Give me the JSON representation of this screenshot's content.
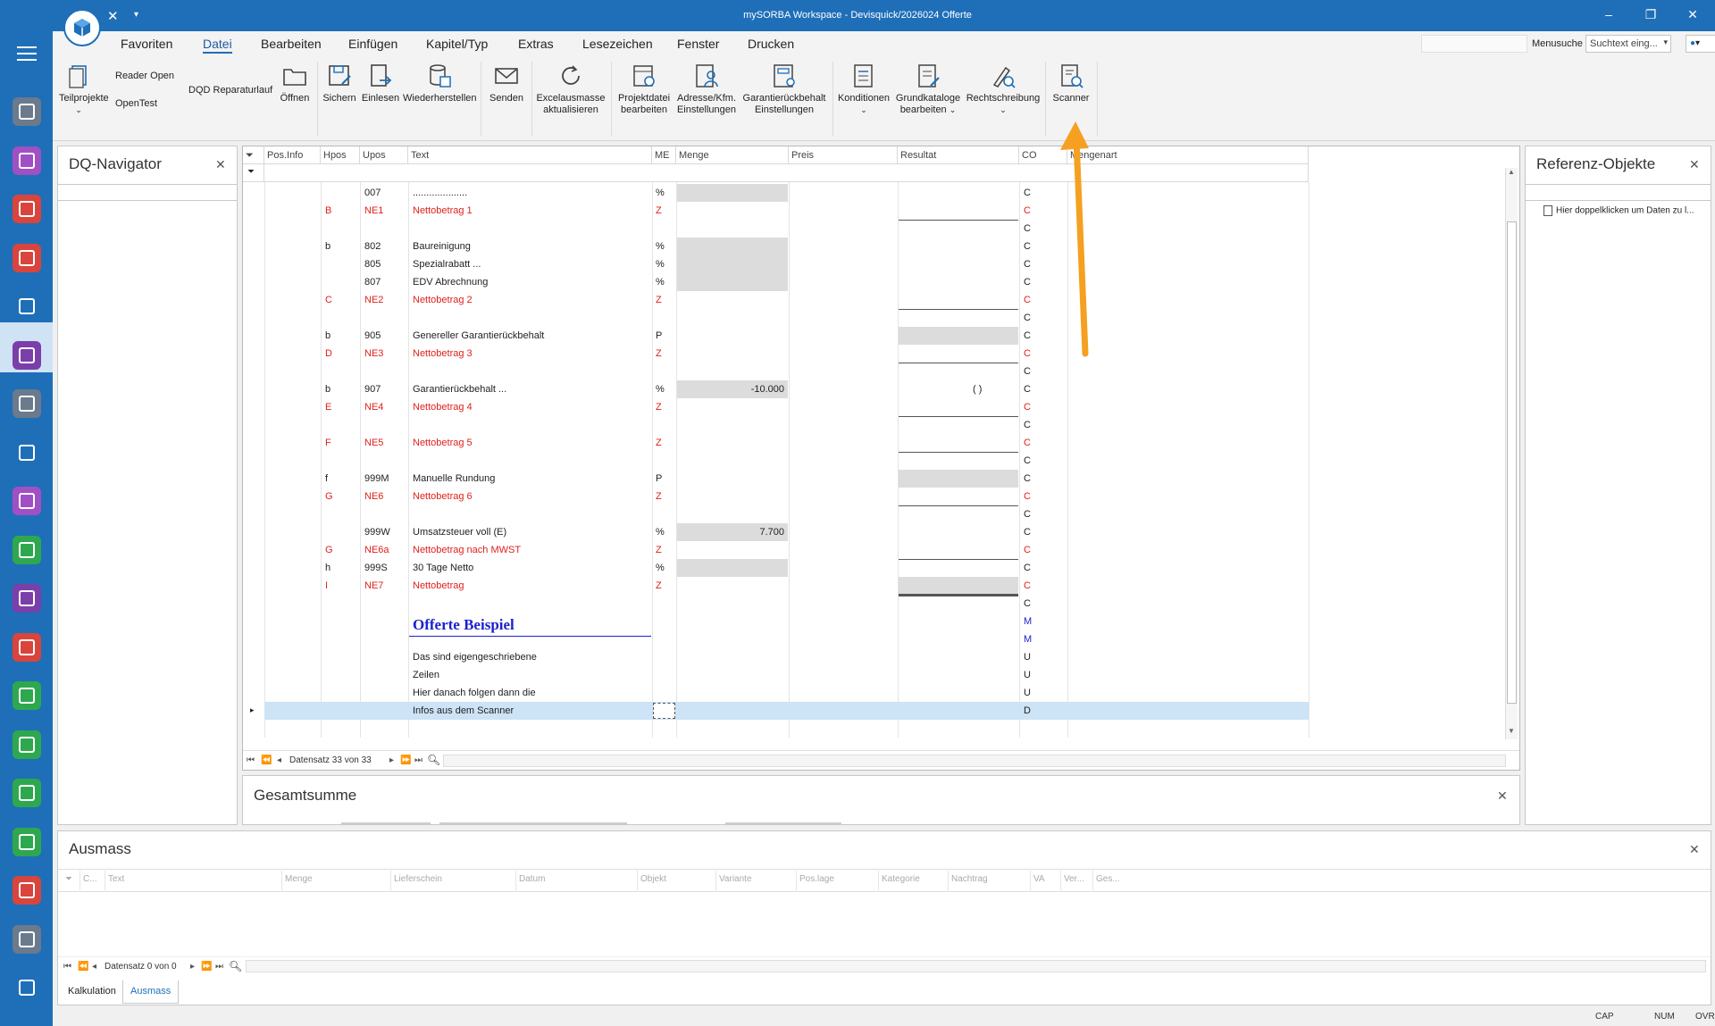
{
  "window": {
    "title": "mySORBA Workspace - Devisquick/2026024 Offerte",
    "minimize": "–",
    "restore": "❐",
    "close": "✕"
  },
  "menu_tabs": [
    "Favoriten",
    "Datei",
    "Bearbeiten",
    "Einfügen",
    "Kapitel/Typ",
    "Extras",
    "Lesezeichen",
    "Fenster",
    "Drucken"
  ],
  "active_tab": "Datei",
  "menusearch": {
    "label": "Menusuche",
    "placeholder": "Suchtext eing..."
  },
  "ribbon": {
    "teilprojekte": "Teilprojekte",
    "reader_open": "Reader Open",
    "opentest": "OpenTest",
    "dqd_reparaturlauf": "DQD Reparaturlauf",
    "oeffnen": "Öffnen",
    "sichern": "Sichern",
    "einlesen": "Einlesen",
    "wiederherstellen": "Wiederherstellen",
    "senden": "Senden",
    "excel1": "Excelausmasse",
    "excel2": "aktualisieren",
    "projekt1": "Projektdatei",
    "projekt2": "bearbeiten",
    "adresse1": "Adresse/Kfm.",
    "adresse2": "Einstellungen",
    "garantie1": "Garantierückbehalt",
    "garantie2": "Einstellungen",
    "konditionen": "Konditionen",
    "grund1": "Grundkataloge",
    "grund2": "bearbeiten",
    "recht": "Rechtschreibung",
    "scanner": "Scanner"
  },
  "dq_navigator": {
    "title": "DQ-Navigator"
  },
  "referenz": {
    "title": "Referenz-Objekte",
    "hint": "Hier doppelklicken um Daten zu l..."
  },
  "grid": {
    "columns": [
      "Pos.Info",
      "Hpos",
      "Upos",
      "Text",
      "ME",
      "Menge",
      "Preis",
      "Resultat",
      "CO",
      "Mengenart"
    ],
    "rows": [
      {
        "hpos": "",
        "upos": "007",
        "text": "....................",
        "me": "%",
        "menge": "",
        "res": "",
        "co": "C",
        "red": false
      },
      {
        "hpos": "B",
        "upos": "NE1",
        "text": "Nettobetrag 1",
        "me": "Z",
        "menge": "",
        "res": "",
        "co": "C",
        "red": true
      },
      {
        "hpos": "",
        "upos": "",
        "text": "",
        "me": "",
        "menge": "",
        "res": "",
        "co": "C",
        "red": false
      },
      {
        "hpos": "b",
        "upos": "802",
        "text": "Baureinigung",
        "me": "%",
        "menge": "",
        "res": "",
        "co": "C",
        "red": false
      },
      {
        "hpos": "",
        "upos": "805",
        "text": "Spezialrabatt ...",
        "me": "%",
        "menge": "",
        "res": "",
        "co": "C",
        "red": false
      },
      {
        "hpos": "",
        "upos": "807",
        "text": "EDV Abrechnung",
        "me": "%",
        "menge": "",
        "res": "",
        "co": "C",
        "red": false
      },
      {
        "hpos": "C",
        "upos": "NE2",
        "text": "Nettobetrag 2",
        "me": "Z",
        "menge": "",
        "res": "",
        "co": "C",
        "red": true
      },
      {
        "hpos": "",
        "upos": "",
        "text": "",
        "me": "",
        "menge": "",
        "res": "",
        "co": "C",
        "red": false
      },
      {
        "hpos": "b",
        "upos": "905",
        "text": "Genereller Garantierückbehalt",
        "me": "P",
        "menge": "",
        "res": "",
        "co": "C",
        "red": false
      },
      {
        "hpos": "D",
        "upos": "NE3",
        "text": "Nettobetrag 3",
        "me": "Z",
        "menge": "",
        "res": "",
        "co": "C",
        "red": true
      },
      {
        "hpos": "",
        "upos": "",
        "text": "",
        "me": "",
        "menge": "",
        "res": "",
        "co": "C",
        "red": false
      },
      {
        "hpos": "b",
        "upos": "907",
        "text": "Garantierückbehalt ...",
        "me": "%",
        "menge": "-10.000",
        "res": "(          )",
        "co": "C",
        "red": false
      },
      {
        "hpos": "E",
        "upos": "NE4",
        "text": "Nettobetrag 4",
        "me": "Z",
        "menge": "",
        "res": "",
        "co": "C",
        "red": true
      },
      {
        "hpos": "",
        "upos": "",
        "text": "",
        "me": "",
        "menge": "",
        "res": "",
        "co": "C",
        "red": false
      },
      {
        "hpos": "F",
        "upos": "NE5",
        "text": "Nettobetrag 5",
        "me": "Z",
        "menge": "",
        "res": "",
        "co": "C",
        "red": true
      },
      {
        "hpos": "",
        "upos": "",
        "text": "",
        "me": "",
        "menge": "",
        "res": "",
        "co": "C",
        "red": false
      },
      {
        "hpos": "f",
        "upos": "999M",
        "text": "Manuelle Rundung",
        "me": "P",
        "menge": "",
        "res": "",
        "co": "C",
        "red": false
      },
      {
        "hpos": "G",
        "upos": "NE6",
        "text": "Nettobetrag 6",
        "me": "Z",
        "menge": "",
        "res": "",
        "co": "C",
        "red": true
      },
      {
        "hpos": "",
        "upos": "",
        "text": "",
        "me": "",
        "menge": "",
        "res": "",
        "co": "C",
        "red": false
      },
      {
        "hpos": "",
        "upos": "999W",
        "text": "Umsatzsteuer voll (E)",
        "me": "%",
        "menge": "7.700",
        "res": "",
        "co": "C",
        "red": false
      },
      {
        "hpos": "G",
        "upos": "NE6a",
        "text": "Nettobetrag nach MWST",
        "me": "Z",
        "menge": "",
        "res": "",
        "co": "C",
        "red": true
      },
      {
        "hpos": "h",
        "upos": "999S",
        "text": "30 Tage Netto",
        "me": "%",
        "menge": "",
        "res": "",
        "co": "C",
        "red": false
      },
      {
        "hpos": "I",
        "upos": "NE7",
        "text": "Nettobetrag",
        "me": "Z",
        "menge": "",
        "res": "",
        "co": "C",
        "red": true
      },
      {
        "hpos": "",
        "upos": "",
        "text": "",
        "me": "",
        "menge": "",
        "res": "",
        "co": "C",
        "red": false
      },
      {
        "hpos": "",
        "upos": "",
        "text": "Offerte Beispiel",
        "me": "",
        "menge": "",
        "res": "",
        "co": "M",
        "red": false,
        "heading": true
      },
      {
        "hpos": "",
        "upos": "",
        "text": "",
        "me": "",
        "menge": "",
        "res": "",
        "co": "M",
        "red": false
      },
      {
        "hpos": "",
        "upos": "",
        "text": "Das sind eigengeschriebene",
        "me": "",
        "menge": "",
        "res": "",
        "co": "U",
        "red": false
      },
      {
        "hpos": "",
        "upos": "",
        "text": "Zeilen",
        "me": "",
        "menge": "",
        "res": "",
        "co": "U",
        "red": false
      },
      {
        "hpos": "",
        "upos": "",
        "text": "Hier danach folgen dann die",
        "me": "",
        "menge": "",
        "res": "",
        "co": "U",
        "red": false
      },
      {
        "hpos": "",
        "upos": "",
        "text": "Infos aus dem Scanner",
        "me": "",
        "menge": "",
        "res": "",
        "co": "D",
        "red": false,
        "selected": true
      }
    ],
    "nav_record": "Datensatz 33 von 33"
  },
  "gesamtsumme": {
    "title": "Gesamtsumme"
  },
  "ausmass": {
    "title": "Ausmass",
    "columns": [
      "C...",
      "Text",
      "Menge",
      "Lieferschein",
      "Datum",
      "Objekt",
      "Variante",
      "Pos.lage",
      "Kategorie",
      "Nachtrag",
      "VA",
      "Ver...",
      "Ges..."
    ],
    "nav_record": "Datensatz 0 von 0"
  },
  "bottom_tabs": [
    "Kalkulation",
    "Ausmass"
  ],
  "active_bottom_tab": "Ausmass",
  "status": [
    "CAP",
    "NUM",
    "OVR"
  ],
  "colors": {
    "brand": "#1e6fb8",
    "red_text": "#e0201c",
    "heading_blue": "#1a22cc",
    "arrow": "#f5a020",
    "selection": "#cde3f6"
  },
  "app_icons": [
    "grid-icon",
    "calendar-icon",
    "planner-icon",
    "table-icon",
    "people-icon",
    "document-edit-icon",
    "calculator-icon",
    "contact-card-icon",
    "tools-icon",
    "plant-icon",
    "notes-icon",
    "network-icon",
    "schedule-icon",
    "package-icon",
    "wrench-icon",
    "chart-icon",
    "report-icon",
    "checklist-icon",
    "cart-icon"
  ]
}
